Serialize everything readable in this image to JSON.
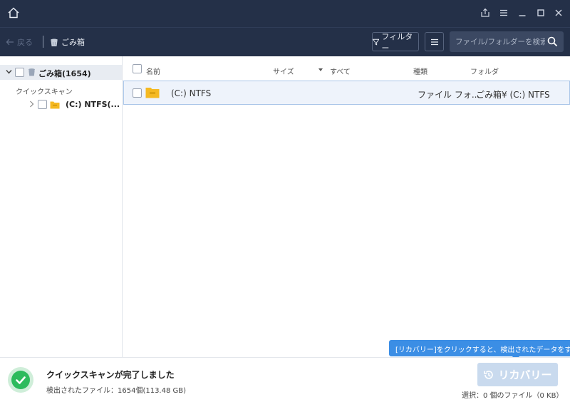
{
  "toolbar": {
    "back_label": "戻る",
    "breadcrumb_label": "ごみ箱",
    "filter_label": "フィルター",
    "search_placeholder": "ファイル/フォルダーを検索"
  },
  "sidebar": {
    "root_label": "ごみ箱(1654)",
    "category_label": "クイックスキャン",
    "child_label": "(C:) NTFS(..."
  },
  "table": {
    "headers": {
      "name": "名前",
      "size": "サイズ",
      "all": "すべて",
      "type": "種類",
      "folder": "フォルダ"
    },
    "rows": [
      {
        "name": "(C:) NTFS",
        "type": "ファイル フォ...",
        "folder": "ごみ箱¥ (C:) NTFS"
      }
    ]
  },
  "tooltip": {
    "text": "[リカバリー]をクリックすると、検出されたデータをすぐ"
  },
  "status": {
    "title": "クイックスキャンが完了しました",
    "detail": "検出されたファイル：1654個(113.48 GB)",
    "recover_label": "リカバリー",
    "selection": "選択：0 個のファイル（0 KB）"
  },
  "colors": {
    "titlebar_bg": "#243048",
    "accent_blue": "#3b8ee5",
    "success_green": "#2dbb5d",
    "folder_yellow": "#f5b921"
  }
}
